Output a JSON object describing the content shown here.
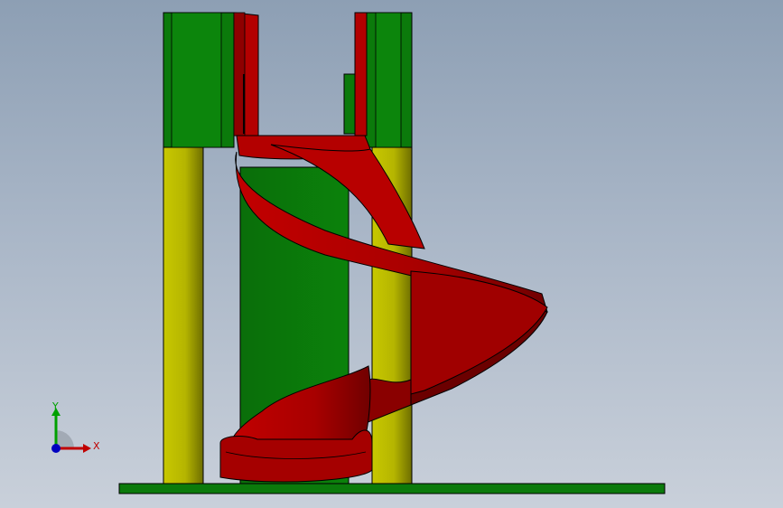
{
  "viewport": {
    "background_top": "#8d9fb4",
    "background_bottom": "#c9d0da"
  },
  "model": {
    "colors": {
      "deck_green": "#0b7a0b",
      "post_yellow": "#b8b800",
      "slide_red": "#b30000",
      "slide_dark": "#6b0000"
    }
  },
  "triad": {
    "x_label": "X",
    "y_label": "Y",
    "x_color": "#c00000",
    "y_color": "#00a000",
    "z_color": "#0000c0"
  }
}
